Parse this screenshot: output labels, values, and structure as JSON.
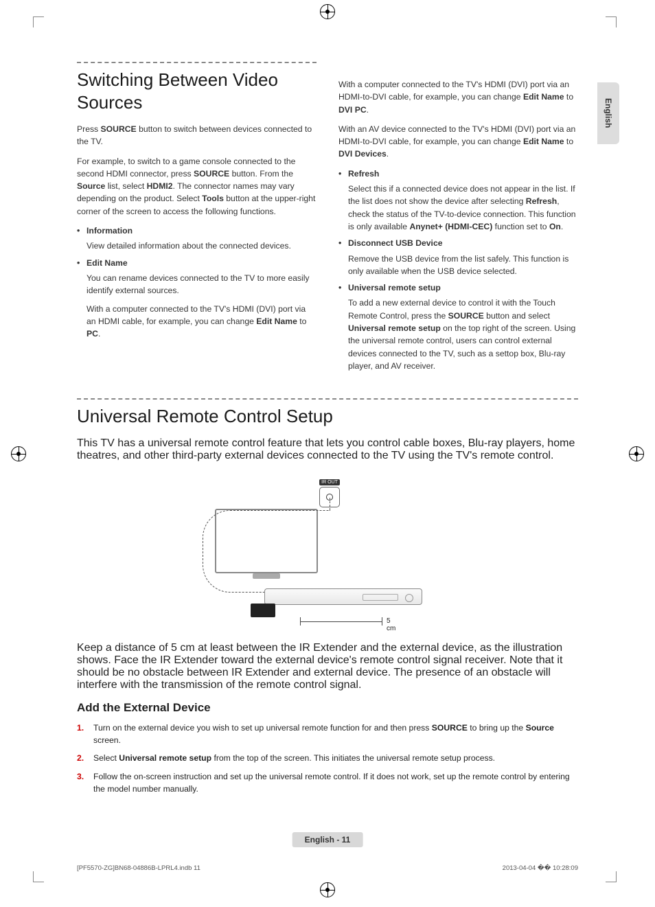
{
  "language_tab": "English",
  "section1": {
    "title": "Switching Between Video Sources",
    "intro_a": "Press ",
    "intro_b": "SOURCE",
    "intro_c": " button to switch between devices connected to the TV.",
    "example_a": "For example, to switch to a game console connected to the second HDMI connector, press ",
    "example_b": "SOURCE",
    "example_c": " button. From the ",
    "example_d": "Source",
    "example_e": " list, select ",
    "example_f": "HDMI2",
    "example_g": ". The connector names may vary depending on the product. Select ",
    "example_h": "Tools",
    "example_i": " button at the upper-right corner of the screen to access the following functions.",
    "items": [
      {
        "label": "Information",
        "desc": "View detailed information about the connected devices."
      },
      {
        "label": "Edit Name",
        "p1_a": "You can rename devices connected to the TV to more easily identify external sources.",
        "p2_a": "With a computer connected to the TV's HDMI (DVI) port via an HDMI cable, for example, you can change ",
        "p2_b": "Edit Name",
        "p2_c": " to ",
        "p2_d": "PC",
        "p2_e": "."
      }
    ],
    "col2": {
      "p1_a": "With a computer connected to the TV's HDMI (DVI) port via an HDMI-to-DVI cable, for example, you can change ",
      "p1_b": "Edit Name",
      "p1_c": " to ",
      "p1_d": "DVI PC",
      "p1_e": ".",
      "p2_a": "With an AV device connected to the TV's HDMI (DVI) port via an HDMI-to-DVI cable, for example, you can change ",
      "p2_b": "Edit Name",
      "p2_c": " to ",
      "p2_d": "DVI Devices",
      "p2_e": ".",
      "items": [
        {
          "label": "Refresh",
          "d_a": "Select this if a connected device does not appear in the list. If the list does not show the device after selecting ",
          "d_b": "Refresh",
          "d_c": ", check the status of the TV-to-device connection. This function is only available ",
          "d_d": "Anynet+ (HDMI-CEC)",
          "d_e": " function set to ",
          "d_f": "On",
          "d_g": "."
        },
        {
          "label": "Disconnect USB Device",
          "d_a": "Remove the USB device from the list safely. This function is only available when the USB device selected."
        },
        {
          "label": "Universal remote setup",
          "d_a": "To add a new external device to control it with the Touch Remote Control, press the ",
          "d_b": "SOURCE",
          "d_c": " button and select ",
          "d_d": "Universal remote setup",
          "d_e": " on the top right of the screen. Using the universal remote control, users can control external devices connected to the TV, such as a settop box, Blu-ray player, and AV receiver."
        }
      ]
    }
  },
  "section2": {
    "title": "Universal Remote Control Setup",
    "intro": "This TV has a universal remote control feature that lets you control cable boxes, Blu-ray players, home theatres, and other third-party external devices connected to the TV using the TV's remote control.",
    "diagram": {
      "ir_out": "IR OUT",
      "distance": "5 cm"
    },
    "note": "Keep a distance of 5 cm at least between the IR Extender and the external device, as the illustration shows. Face the IR Extender toward the external device's remote control signal receiver. Note that it should be no obstacle between IR Extender and external device. The presence of an obstacle will interfere with the transmission of the remote control signal.",
    "sub": "Add the External Device",
    "steps": [
      {
        "a": "Turn on the external device you wish to set up universal remote function for and then press ",
        "b": "SOURCE",
        "c": " to bring up the ",
        "d": "Source",
        "e": " screen."
      },
      {
        "a": "Select ",
        "b": "Universal remote setup",
        "c": " from the top of the screen. This initiates the universal remote setup process."
      },
      {
        "a": "Follow the on-screen instruction and set up the universal remote control. If it does not work, set up the remote control by entering the model number manually."
      }
    ]
  },
  "footer": {
    "page": "English - 11",
    "file": "[PF5570-ZG]BN68-04886B-LPRL4.indb   11",
    "timestamp": "2013-04-04   �� 10:28:09"
  }
}
